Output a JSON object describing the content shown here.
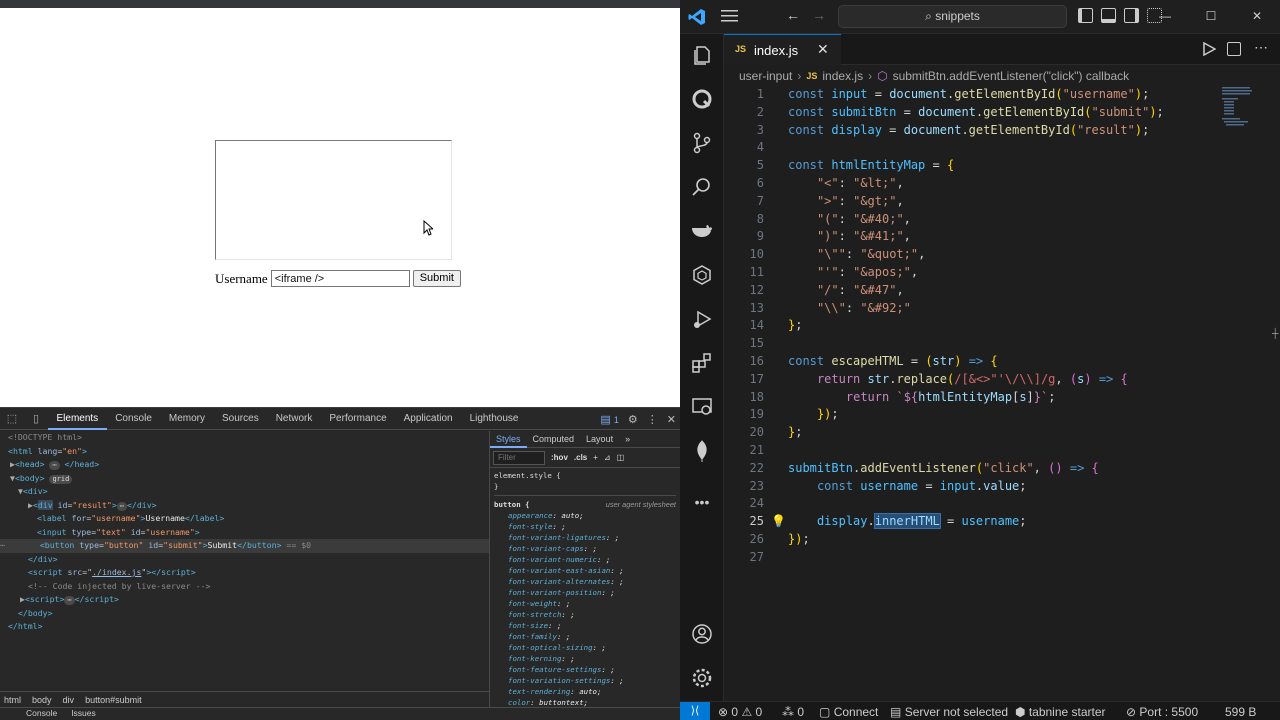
{
  "browser": {
    "form": {
      "label": "Username",
      "input_value": "<iframe />",
      "submit_label": "Submit"
    }
  },
  "devtools": {
    "tabs": [
      "Elements",
      "Console",
      "Memory",
      "Sources",
      "Network",
      "Performance",
      "Application",
      "Lighthouse"
    ],
    "active_tab": "Elements",
    "issues_count": "1",
    "dom": {
      "doctype": "<!DOCTYPE html>",
      "html_tag": "html",
      "html_attr": "lang",
      "html_attr_val": "\"en\"",
      "head": "head",
      "body": "body",
      "grid_badge": "grid",
      "div": "div",
      "div_result_attr": "id",
      "div_result_val": "\"result\"",
      "label_attr": "for",
      "label_val": "\"username\"",
      "label_text": "Username",
      "input_type_attr": "type",
      "input_type_val": "\"text\"",
      "input_id_attr": "id",
      "input_id_val": "\"username\"",
      "button_type_attr": "type",
      "button_type_val": "\"button\"",
      "button_id_attr": "id",
      "button_id_val": "\"submit\"",
      "button_text": "Submit",
      "selected_marker": "== $0",
      "script_src_attr": "src",
      "script_src_val": "./index.js",
      "comment": "<!-- Code injected by live-server -->",
      "script": "script"
    },
    "breadcrumb": [
      "html",
      "body",
      "div",
      "button#submit"
    ],
    "drawer_tabs": [
      "Console",
      "Issues"
    ],
    "styles": {
      "tabs": [
        "Styles",
        "Computed",
        "Layout"
      ],
      "filter_placeholder": "Filter",
      "hov": ":hov",
      "cls": ".cls",
      "element_style": "element.style {",
      "close_brace": "}",
      "selector": "button {",
      "ua_label": "user agent stylesheet",
      "props": [
        {
          "name": "appearance",
          "value": "auto;"
        },
        {
          "name": "font-style",
          "value": ";"
        },
        {
          "name": "font-variant-ligatures",
          "value": ";"
        },
        {
          "name": "font-variant-caps",
          "value": ";"
        },
        {
          "name": "font-variant-numeric",
          "value": ";"
        },
        {
          "name": "font-variant-east-asian",
          "value": ";"
        },
        {
          "name": "font-variant-alternates",
          "value": ";"
        },
        {
          "name": "font-variant-position",
          "value": ";"
        },
        {
          "name": "font-weight",
          "value": ";"
        },
        {
          "name": "font-stretch",
          "value": ";"
        },
        {
          "name": "font-size",
          "value": ";"
        },
        {
          "name": "font-family",
          "value": ";"
        },
        {
          "name": "font-optical-sizing",
          "value": ";"
        },
        {
          "name": "font-kerning",
          "value": ";"
        },
        {
          "name": "font-feature-settings",
          "value": ";"
        },
        {
          "name": "font-variation-settings",
          "value": ";"
        },
        {
          "name": "text-rendering",
          "value": "auto;"
        },
        {
          "name": "color",
          "value": "buttontext;"
        }
      ]
    }
  },
  "vscode": {
    "search_text": "snippets",
    "tab": {
      "badge": "JS",
      "label": "index.js"
    },
    "breadcrumb": {
      "folder": "user-input",
      "file": "index.js",
      "symbol": "submitBtn.addEventListener(\"click\") callback"
    },
    "code_lines": [
      "const input = document.getElementById(\"username\");",
      "const submitBtn = document.getElementById(\"submit\");",
      "const display = document.getElementById(\"result\");",
      "",
      "const htmlEntityMap = {",
      "    \"<\": \"&lt;\",",
      "    \">\": \"&gt;\",",
      "    \"(\": \"&#40;\",",
      "    \")\": \"&#41;\",",
      "    \"\\\"\": \"&quot;\",",
      "    \"'\": \"&apos;\",",
      "    \"/\": \"&#47\",",
      "    \"\\\\\": \"&#92;\"",
      "};",
      "",
      "const escapeHTML = (str) => {",
      "    return str.replace(/[&<>\"'\\/\\\\]/g, (s) => {",
      "        return `${htmlEntityMap[s]}`;",
      "    });",
      "};",
      "",
      "submitBtn.addEventListener(\"click\", () => {",
      "    const username = input.value;",
      "",
      "    display.innerHTML = username;",
      "});",
      ""
    ],
    "current_line": 25,
    "status_bar": {
      "errors": "0",
      "warnings": "0",
      "ports": "0",
      "connect": "Connect",
      "server": "Server not selected",
      "tabnine": "tabnine starter",
      "port": "Port : 5500",
      "size": "599 B"
    }
  },
  "icons": [
    "vscode-logo-icon",
    "menu-icon",
    "explorer-icon",
    "search-icon",
    "source-control-icon",
    "run-debug-icon",
    "extensions-icon",
    "docker-icon",
    "accounts-icon",
    "settings-gear-icon"
  ],
  "colors": {
    "accent": "#0078d4",
    "devtools_link": "#7cacf8"
  }
}
